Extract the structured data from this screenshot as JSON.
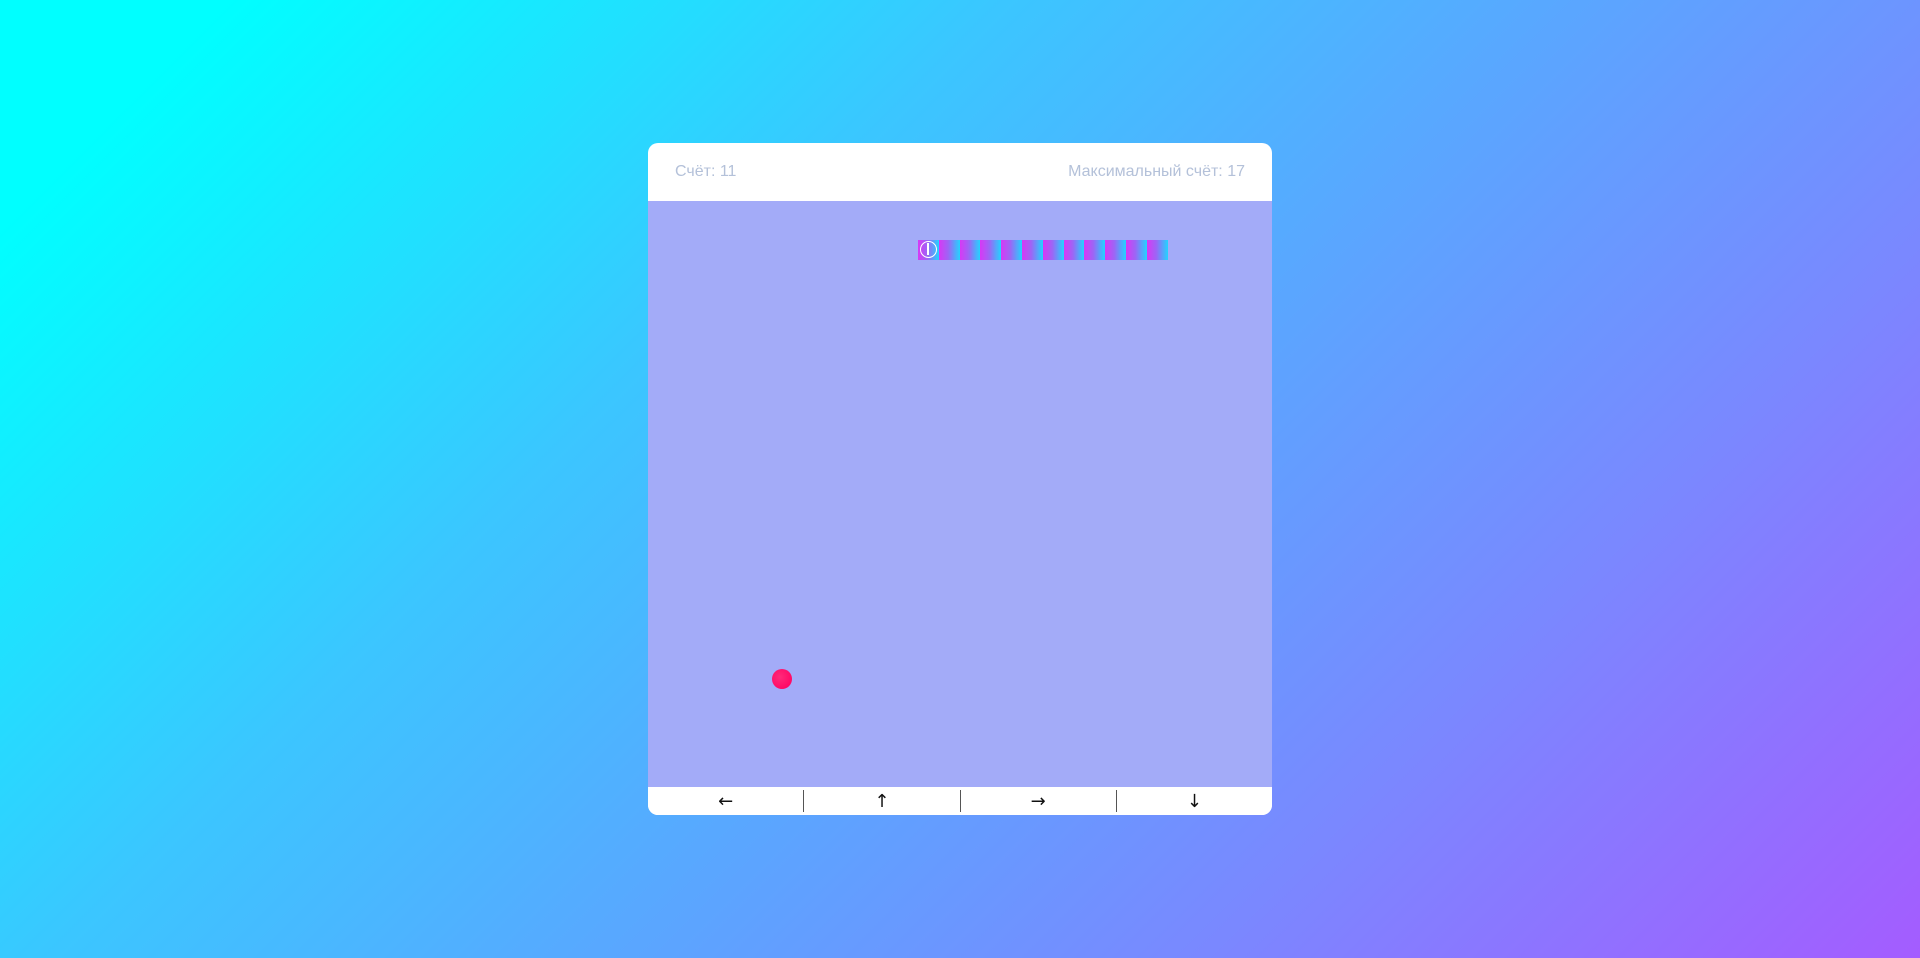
{
  "game": {
    "score_label": "Счёт: 11",
    "best_label": "Максимальный счёт: 17"
  },
  "snake": {
    "length": 12,
    "head_direction": "left"
  },
  "controls": {
    "left": "←",
    "up": "↑",
    "right": "→",
    "down": "↓"
  },
  "colors": {
    "board": "#a3abf8",
    "food": "#ff0a66",
    "snake_start": "#d838f5",
    "snake_end": "#22d4ff",
    "header_text": "#b4c1d9"
  }
}
